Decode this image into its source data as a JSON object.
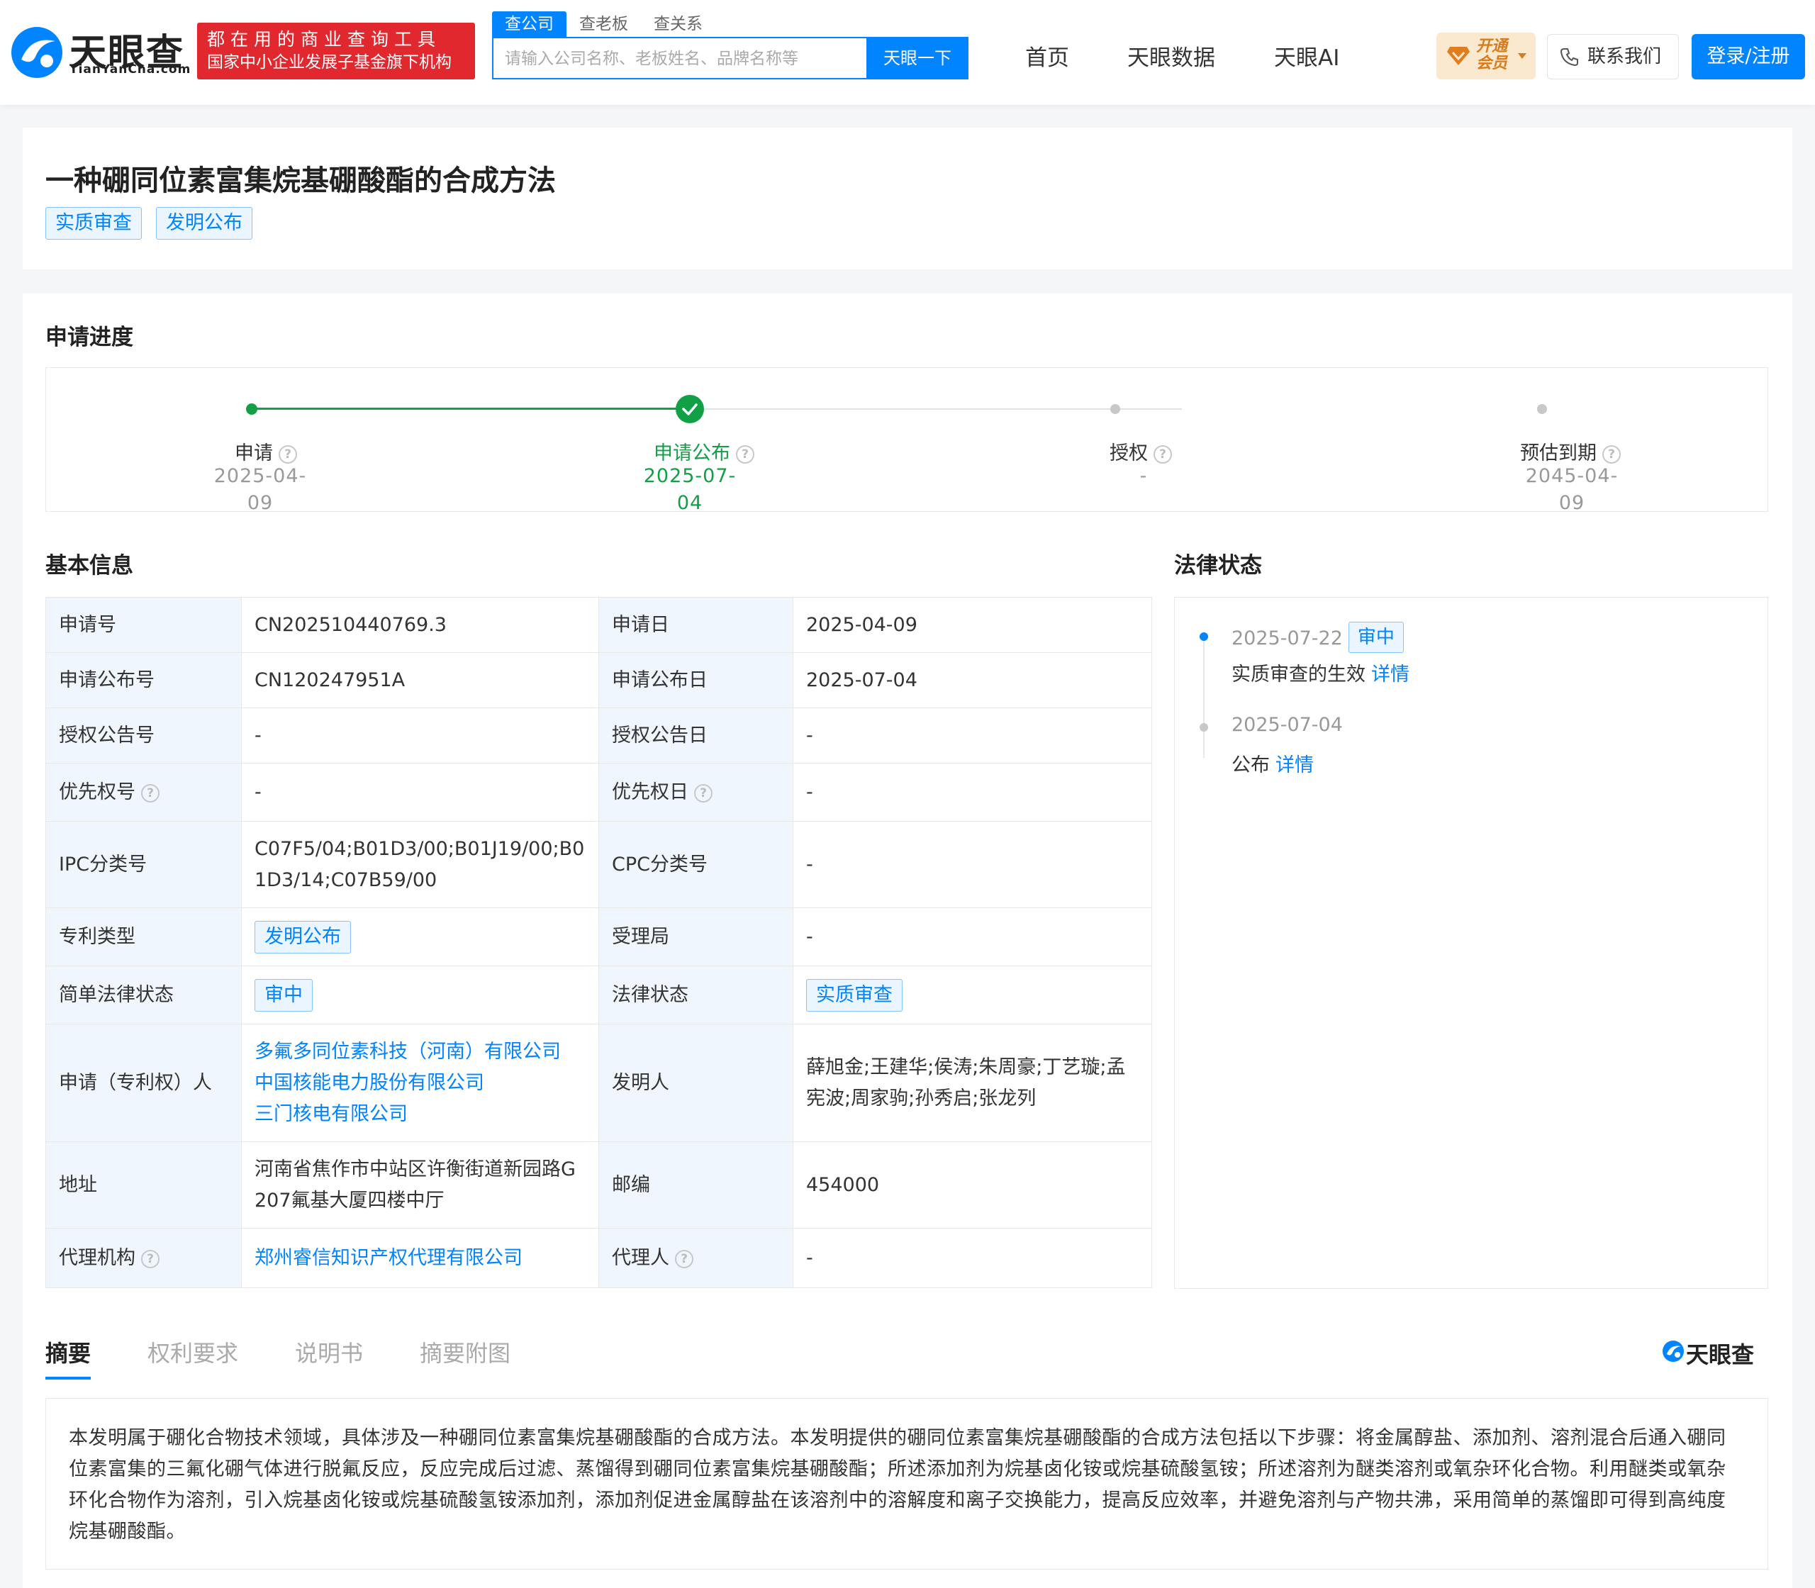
{
  "header": {
    "logo_text": "天眼查",
    "logo_sub": "TianYanCha.com",
    "slogan_line1": "都在用的商业查询工具",
    "slogan_line2": "国家中小企业发展子基金旗下机构",
    "search_tabs": [
      "查公司",
      "查老板",
      "查关系"
    ],
    "search_placeholder": "请输入公司名称、老板姓名、品牌名称等",
    "search_button": "天眼一下",
    "nav": [
      "首页",
      "天眼数据",
      "天眼AI"
    ],
    "vip_line1": "开通",
    "vip_line2": "会员",
    "contact": "联系我们",
    "login": "登录/注册"
  },
  "patent": {
    "title": "一种硼同位素富集烷基硼酸酯的合成方法",
    "tags": [
      "实质审查",
      "发明公布"
    ]
  },
  "progress": {
    "title": "申请进度",
    "steps": [
      {
        "label": "申请",
        "date": "2025-04-09"
      },
      {
        "label": "申请公布",
        "date": "2025-07-04"
      },
      {
        "label": "授权",
        "date": "-"
      },
      {
        "label": "预估到期",
        "date": "2045-04-09"
      }
    ]
  },
  "basic_info": {
    "title": "基本信息",
    "rows": [
      {
        "l1": "申请号",
        "v1": "CN202510440769.3",
        "l2": "申请日",
        "v2": "2025-04-09"
      },
      {
        "l1": "申请公布号",
        "v1": "CN120247951A",
        "l2": "申请公布日",
        "v2": "2025-07-04"
      },
      {
        "l1": "授权公告号",
        "v1": "-",
        "l2": "授权公告日",
        "v2": "-"
      },
      {
        "l1": "优先权号",
        "v1": "-",
        "l2": "优先权日",
        "v2": "-"
      },
      {
        "l1": "IPC分类号",
        "v1": "C07F5/04;B01D3/00;B01J19/00;B01D3/14;C07B59/00",
        "l2": "CPC分类号",
        "v2": "-"
      },
      {
        "l1": "专利类型",
        "v1": "发明公布",
        "l2": "受理局",
        "v2": "-"
      },
      {
        "l1": "简单法律状态",
        "v1": "审中",
        "l2": "法律状态",
        "v2": "实质审查"
      },
      {
        "l1": "申请（专利权）人",
        "v1a": "多氟多同位素科技（河南）有限公司",
        "v1b": "中国核能电力股份有限公司",
        "v1c": "三门核电有限公司",
        "l2": "发明人",
        "v2": "薛旭金;王建华;侯涛;朱周豪;丁艺璇;孟宪波;周家驹;孙秀启;张龙列"
      },
      {
        "l1": "地址",
        "v1": "河南省焦作市中站区许衡街道新园路G207氟基大厦四楼中厅",
        "l2": "邮编",
        "v2": "454000"
      },
      {
        "l1": "代理机构",
        "v1": "郑州睿信知识产权代理有限公司",
        "l2": "代理人",
        "v2": "-"
      }
    ]
  },
  "legal_status": {
    "title": "法律状态",
    "events": [
      {
        "date": "2025-07-22",
        "tag": "审中",
        "desc": "实质审查的生效",
        "more": "详情"
      },
      {
        "date": "2025-07-04",
        "desc": "公布",
        "more": "详情"
      }
    ]
  },
  "tabs": [
    "摘要",
    "权利要求",
    "说明书",
    "摘要附图"
  ],
  "brand_mark": "天眼查",
  "abstract": "本发明属于硼化合物技术领域，具体涉及一种硼同位素富集烷基硼酸酯的合成方法。本发明提供的硼同位素富集烷基硼酸酯的合成方法包括以下步骤：将金属醇盐、添加剂、溶剂混合后通入硼同位素富集的三氟化硼气体进行脱氟反应，反应完成后过滤、蒸馏得到硼同位素富集烷基硼酸酯；所述添加剂为烷基卤化铵或烷基硫酸氢铵；所述溶剂为醚类溶剂或氧杂环化合物。利用醚类或氧杂环化合物作为溶剂，引入烷基卤化铵或烷基硫酸氢铵添加剂，添加剂促进金属醇盐在该溶剂中的溶解度和离子交换能力，提高反应效率，并避免溶剂与产物共沸，采用简单的蒸馏即可得到高纯度烷基硼酸酯。",
  "colors": {
    "accent": "#0084ff",
    "success": "#12a047",
    "slogan_bg": "#e0282e",
    "label_bg": "#f0f6fd"
  }
}
